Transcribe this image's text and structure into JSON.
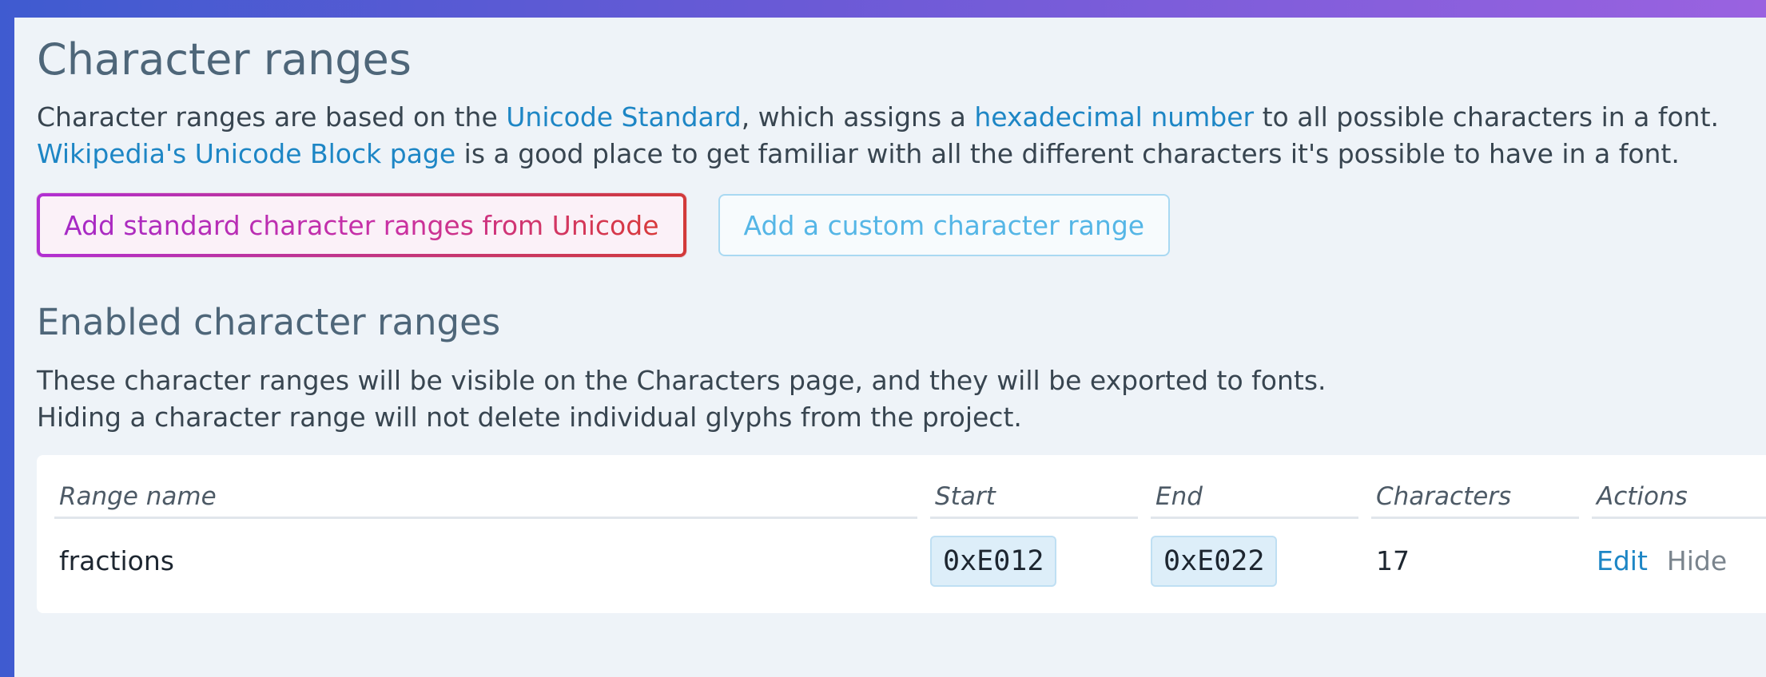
{
  "page": {
    "title": "Character ranges",
    "intro": {
      "p1": "Character ranges are based on the ",
      "link_unicode": "Unicode Standard",
      "p2": ", which assigns a ",
      "link_hex": "hexadecimal number",
      "p3": " to all possible characters in a font.",
      "link_wiki": "Wikipedia's Unicode Block page",
      "p4": " is a good place to get familiar with all the different characters it's possible to have in a font."
    },
    "buttons": {
      "add_standard": "Add standard character ranges from Unicode",
      "add_custom": "Add a custom character range"
    },
    "enabled": {
      "title": "Enabled character ranges",
      "desc1": "These character ranges will be visible on the Characters page, and they will be exported to fonts.",
      "desc2": "Hiding a character range will not delete individual glyphs from the project."
    },
    "table": {
      "headers": {
        "name": "Range name",
        "start": "Start",
        "end": "End",
        "characters": "Characters",
        "actions": "Actions"
      },
      "rows": [
        {
          "name": "fractions",
          "start": "0xE012",
          "end": "0xE022",
          "characters": "17",
          "edit": "Edit",
          "hide": "Hide"
        }
      ]
    }
  },
  "colors": {
    "link": "#1d86c5",
    "heading": "#4e6679",
    "primary_gradient_start": "#b12fd3",
    "primary_gradient_end": "#d23a3a",
    "secondary_text": "#55b6e6"
  }
}
